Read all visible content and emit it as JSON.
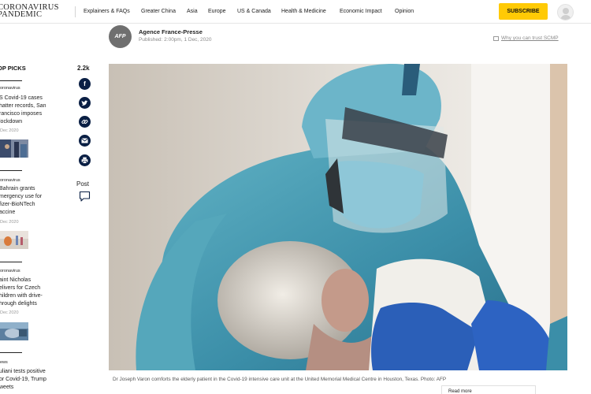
{
  "header": {
    "logo_line1": "CORONAVIRUS",
    "logo_line2": "PANDEMIC",
    "nav": [
      "Explainers & FAQs",
      "Greater China",
      "Asia",
      "Europe",
      "US & Canada",
      "Health & Medicine",
      "Economic Impact",
      "Opinion"
    ],
    "subscribe_label": "SUBSCRIBE",
    "avatar_icon": "user-icon"
  },
  "byline": {
    "badge": "AFP",
    "author": "Agence France-Presse",
    "published": "Published: 2:00pm, 1 Dec, 2020",
    "trust_link": "Why you can trust SCMP"
  },
  "sidebar": {
    "heading": "OP PICKS",
    "items": [
      {
        "label": "oronavirus",
        "title": "S Covid-19 cases\nhatter records, San\nrancisco imposes\nlockdown",
        "date": "Dec 2020"
      },
      {
        "label": "oronavirus",
        "title": "Bahrain grants\nmergency use for\nfizer-BioNTech\naccine",
        "date": "Dec 2020"
      },
      {
        "label": "oronavirus",
        "title": "aint Nicholas\nelivers for Czech\nhildren with drive-\nhrough delights",
        "date": "Dec 2020"
      },
      {
        "label": "ews",
        "title": "uliani tests positive\nor Covid-19, Trump\nweets",
        "date": ""
      }
    ]
  },
  "share": {
    "count": "2.2k",
    "buttons": [
      "facebook-icon",
      "twitter-icon",
      "link-icon",
      "email-icon",
      "print-icon"
    ],
    "post_label": "Post",
    "post_icon": "comment-icon"
  },
  "article": {
    "image_description_icon": "photo",
    "caption": "Dr Joseph Varon comforts the elderly patient in the Covid-19 intensive care unit at the United Memorial Medical Centre in Houston, Texas. Photo: AFP",
    "read_more": "Read more"
  },
  "colors": {
    "accent": "#ffca05",
    "share_bg": "#0a1f44",
    "gown": "#3f8fa6"
  }
}
